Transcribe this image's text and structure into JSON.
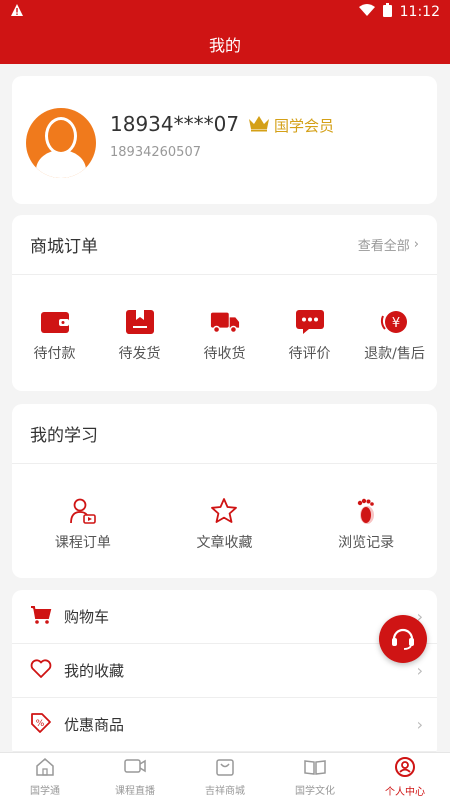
{
  "status_bar": {
    "time": "11:12"
  },
  "header": {
    "title": "我的"
  },
  "profile": {
    "username": "18934****07",
    "vip_label": "国学会员",
    "user_id": "18934260507"
  },
  "orders": {
    "title": "商城订单",
    "see_all": "查看全部",
    "items": [
      {
        "label": "待付款",
        "icon": "wallet-icon"
      },
      {
        "label": "待发货",
        "icon": "package-icon"
      },
      {
        "label": "待收货",
        "icon": "truck-icon"
      },
      {
        "label": "待评价",
        "icon": "chat-icon"
      },
      {
        "label": "退款/售后",
        "icon": "refund-icon"
      }
    ]
  },
  "study": {
    "title": "我的学习",
    "items": [
      {
        "label": "课程订单",
        "icon": "course-order-icon"
      },
      {
        "label": "文章收藏",
        "icon": "star-icon"
      },
      {
        "label": "浏览记录",
        "icon": "footprint-icon"
      }
    ]
  },
  "menu": [
    {
      "label": "购物车",
      "icon": "cart-icon"
    },
    {
      "label": "我的收藏",
      "icon": "heart-icon"
    },
    {
      "label": "优惠商品",
      "icon": "discount-icon"
    }
  ],
  "tabbar": [
    {
      "label": "国学通",
      "icon": "home-icon"
    },
    {
      "label": "课程直播",
      "icon": "video-icon"
    },
    {
      "label": "吉祥商城",
      "icon": "bag-icon"
    },
    {
      "label": "国学文化",
      "icon": "book-icon"
    },
    {
      "label": "个人中心",
      "icon": "user-icon"
    }
  ],
  "colors": {
    "brand": "#cf1414",
    "vip": "#d4a017",
    "avatar": "#f07a1c"
  }
}
